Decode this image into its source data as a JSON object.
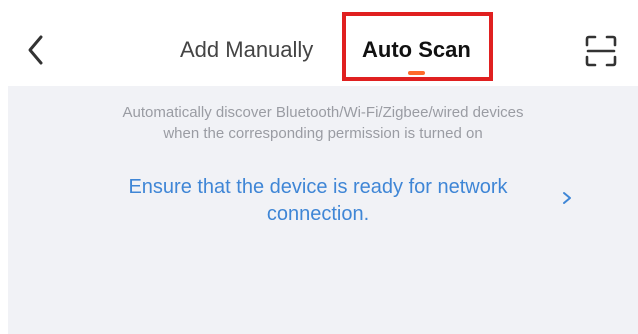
{
  "header": {
    "back_icon": "chevron-left-icon",
    "tabs": [
      {
        "label": "Add Manually",
        "selected": false
      },
      {
        "label": "Auto Scan",
        "selected": true
      }
    ],
    "scan_icon": "scan-qr-icon",
    "indicator_color": "#ff6a2b",
    "highlight_color": "#e02020"
  },
  "main": {
    "description_lines": [
      "Automatically discover Bluetooth/Wi-Fi/Zigbee/wired devices",
      "when the corresponding permission is turned on"
    ],
    "network_link": {
      "lines": [
        "Ensure that the device is ready for network",
        "connection."
      ],
      "icon": "chevron-right-icon",
      "color": "#3f86d6"
    },
    "background_color": "#f1f2f6"
  }
}
